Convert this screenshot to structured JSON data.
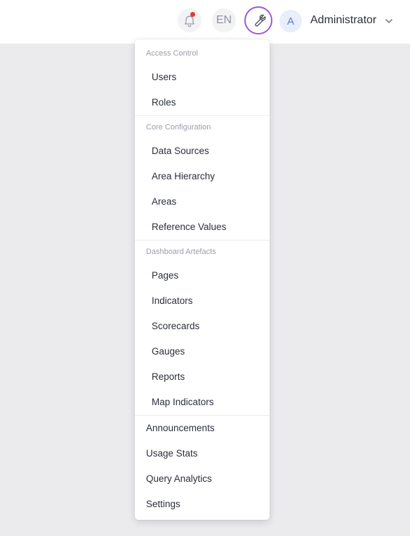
{
  "header": {
    "language": "EN",
    "avatar_initial": "A",
    "user_name": "Administrator",
    "notification_dot_color": "#e53935",
    "active_accent": "#9b59d9",
    "icons": [
      "bell-icon",
      "wrench-icon",
      "chevron-down-icon"
    ]
  },
  "menu": {
    "access_control": {
      "title": "Access Control",
      "items": [
        "Users",
        "Roles"
      ]
    },
    "core_configuration": {
      "title": "Core Configuration",
      "items": [
        "Data Sources",
        "Area Hierarchy",
        "Areas",
        "Reference Values"
      ]
    },
    "dashboard_artefacts": {
      "title": "Dashboard Artefacts",
      "items": [
        "Pages",
        "Indicators",
        "Scorecards",
        "Gauges",
        "Reports",
        "Map Indicators"
      ]
    },
    "top_level": [
      "Announcements",
      "Usage Stats",
      "Query Analytics",
      "Settings"
    ]
  }
}
